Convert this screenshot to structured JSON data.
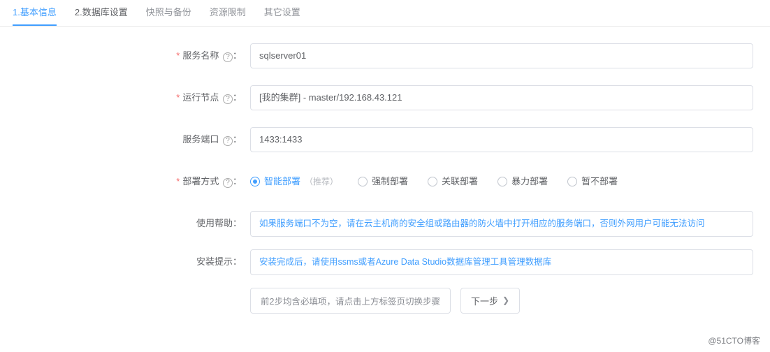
{
  "tabs": [
    {
      "index": "1.",
      "label": "基本信息",
      "state": "active"
    },
    {
      "index": "2.",
      "label": "数据库设置",
      "state": "numbered"
    },
    {
      "index": "",
      "label": "快照与备份",
      "state": "dim"
    },
    {
      "index": "",
      "label": "资源限制",
      "state": "dim"
    },
    {
      "index": "",
      "label": "其它设置",
      "state": "dim"
    }
  ],
  "form": {
    "service_name": {
      "label": "服务名称",
      "value": "sqlserver01",
      "required": true,
      "help": true
    },
    "run_node": {
      "label": "运行节点",
      "value": "[我的集群] - master/192.168.43.121",
      "required": true,
      "help": true
    },
    "service_port": {
      "label": "服务端口",
      "value": "1433:1433",
      "required": false,
      "help": true
    },
    "deploy_mode": {
      "label": "部署方式",
      "required": true,
      "help": true,
      "options": [
        {
          "label": "智能部署",
          "note": "（推荐）",
          "selected": true
        },
        {
          "label": "强制部署",
          "selected": false
        },
        {
          "label": "关联部署",
          "selected": false
        },
        {
          "label": "暴力部署",
          "selected": false
        },
        {
          "label": "暂不部署",
          "selected": false
        }
      ]
    },
    "usage_help": {
      "label": "使用帮助：",
      "text": "如果服务端口不为空，请在云主机商的安全组或路由器的防火墙中打开相应的服务端口，否则外网用户可能无法访问"
    },
    "install_tip": {
      "label": "安装提示：",
      "text": "安装完成后，请使用ssms或者Azure Data Studio数据库管理工具管理数据库"
    }
  },
  "footer": {
    "hint": "前2步均含必填项，请点击上方标签页切换步骤",
    "next": "下一步"
  },
  "watermark": "@51CTO博客",
  "glyph": {
    "q": "?",
    "arrow": "❯",
    "colon": "："
  }
}
